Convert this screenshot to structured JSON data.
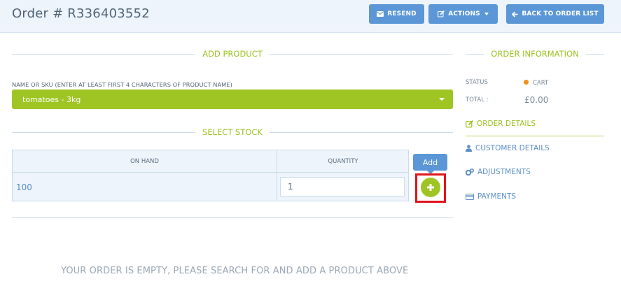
{
  "header": {
    "title": "Order # R336403552",
    "buttons": {
      "resend": "RESEND",
      "actions": "ACTIONS",
      "back": "BACK TO ORDER LIST"
    }
  },
  "add_product": {
    "heading": "ADD PRODUCT",
    "field_label": "NAME OR SKU (ENTER AT LEAST FIRST 4 CHARACTERS OF PRODUCT NAME)",
    "selected_product": "tomatoes - 3kg"
  },
  "select_stock": {
    "heading": "SELECT STOCK",
    "columns": [
      "ON HAND",
      "QUANTITY"
    ],
    "row": {
      "on_hand": "100",
      "quantity": "1"
    },
    "add_tooltip": "Add"
  },
  "empty_message": "YOUR ORDER IS EMPTY, PLEASE SEARCH FOR AND ADD A PRODUCT ABOVE",
  "order_information": {
    "heading": "ORDER INFORMATION",
    "status_label": "STATUS",
    "status_value": "CART",
    "total_label": "TOTAL :",
    "total_value": "£0.00",
    "links": {
      "order_details": "ORDER DETAILS",
      "customer_details": "CUSTOMER DETAILS",
      "adjustments": "ADJUSTMENTS",
      "payments": "PAYMENTS"
    }
  },
  "colors": {
    "primary_blue": "#5b97d6",
    "accent_green": "#9fc524",
    "status_cart": "#f0921a",
    "highlight_red": "#e0141a"
  },
  "icons": [
    "envelope-icon",
    "edit-icon",
    "arrow-left-icon",
    "plus-icon",
    "user-icon",
    "cogs-icon",
    "credit-card-icon"
  ]
}
